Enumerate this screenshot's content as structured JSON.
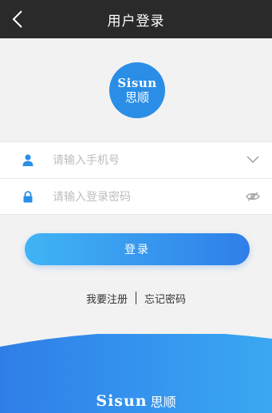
{
  "header": {
    "title": "用户登录"
  },
  "logo": {
    "brand_en": "Sisun",
    "brand_cn": "思顺"
  },
  "form": {
    "phone": {
      "placeholder": "请输入手机号",
      "value": ""
    },
    "password": {
      "placeholder": "请输入登录密码",
      "value": ""
    }
  },
  "actions": {
    "login_label": "登录",
    "register_label": "我要注册",
    "forgot_label": "忘记密码"
  },
  "footer": {
    "brand_en": "Sisun",
    "brand_cn": "思顺"
  },
  "colors": {
    "header_bg": "#2b2a2a",
    "accent": "#2f7ee8",
    "accent_light": "#40b4f5",
    "icon_blue": "#2a8ee6"
  },
  "icons": {
    "back": "chevron-left-icon",
    "user": "user-icon",
    "lock": "lock-icon",
    "dropdown": "chevron-down-icon",
    "visibility": "eye-off-icon"
  }
}
